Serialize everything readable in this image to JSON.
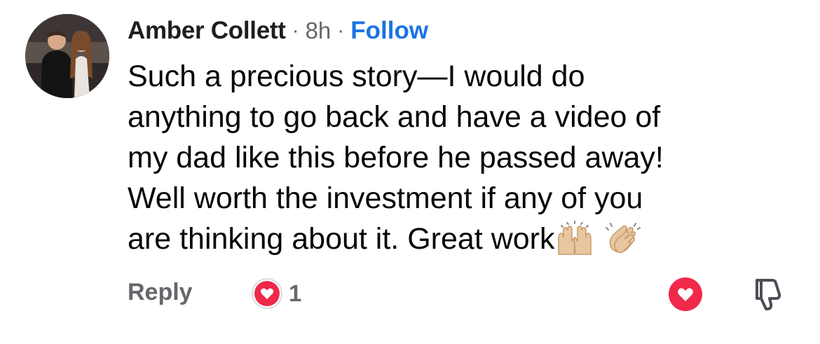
{
  "comment": {
    "author": "Amber Collett",
    "separator": "·",
    "time": "8h",
    "follow_label": "Follow",
    "text_lines": [
      "Such a precious story—I would do",
      "anything to go back and have a video of",
      "my dad like this before he passed away!",
      "Well worth the investment if any of you",
      "are thinking about it. Great work"
    ],
    "emojis": [
      "raising-hands-emoji",
      "clapping-hands-emoji"
    ]
  },
  "actions": {
    "reply_label": "Reply",
    "reaction_icon": "heart-reaction-icon",
    "reaction_count": "1",
    "love_icon": "heart-icon",
    "dislike_icon": "thumbs-down-icon"
  },
  "colors": {
    "author": "#1c1e21",
    "meta": "#65676b",
    "follow": "#1b74e4",
    "heart": "#f0284a",
    "text": "#050505"
  }
}
